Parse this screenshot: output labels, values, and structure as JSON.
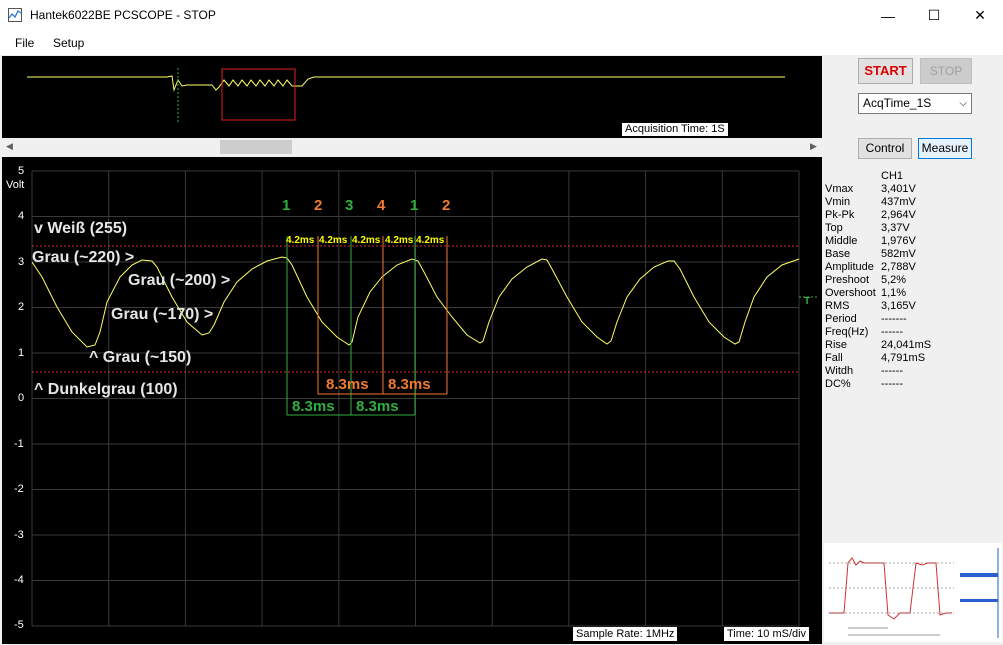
{
  "window": {
    "title": "Hantek6022BE PCSCOPE - STOP",
    "minimize": "—",
    "maximize": "☐",
    "close": "✕"
  },
  "menu": [
    "File",
    "Setup"
  ],
  "overview": {
    "acq_time_label": "Acquisition Time: 1S"
  },
  "scope": {
    "y_unit": "Volt",
    "y_ticks": [
      "5",
      "4",
      "3",
      "2",
      "1",
      "0",
      "-1",
      "-2",
      "-3",
      "-4",
      "-5"
    ],
    "annotations": [
      "v Weiß (255)",
      "Grau (~220) >",
      "Grau (~200) >",
      "Grau (~170) >",
      "^ Grau (~150)",
      "^ Dunkelgrau (100)"
    ],
    "pulse_numbers": [
      {
        "text": "1",
        "color": "#2fb040"
      },
      {
        "text": "2",
        "color": "#f07a30"
      },
      {
        "text": "3",
        "color": "#2fb040"
      },
      {
        "text": "4",
        "color": "#f07a30"
      },
      {
        "text": "1",
        "color": "#2fb040"
      },
      {
        "text": "2",
        "color": "#f07a30"
      }
    ],
    "small_intervals": [
      "4.2ms",
      "4.2ms",
      "4.2ms",
      "4.2ms",
      "4.2ms"
    ],
    "big_intervals": [
      {
        "text": "8.3ms",
        "color": "#f07a30"
      },
      {
        "text": "8.3ms",
        "color": "#f07a30"
      },
      {
        "text": "8.3ms",
        "color": "#2fb040"
      },
      {
        "text": "8.3ms",
        "color": "#2fb040"
      }
    ],
    "sample_rate": "Sample Rate: 1MHz",
    "time_div": "Time: 10 mS/div",
    "trigger_marker": "T"
  },
  "controls": {
    "start": "START",
    "stop": "STOP",
    "acq_select": "AcqTime_1S",
    "control_btn": "Control",
    "measure_btn": "Measure"
  },
  "measurements": {
    "channel": "CH1",
    "rows": [
      {
        "name": "Vmax",
        "value": "3,401V"
      },
      {
        "name": "Vmin",
        "value": "437mV"
      },
      {
        "name": "Pk-Pk",
        "value": "2,964V"
      },
      {
        "name": "Top",
        "value": "3,37V"
      },
      {
        "name": "Middle",
        "value": "1,976V"
      },
      {
        "name": "Base",
        "value": "582mV"
      },
      {
        "name": "Amplitude",
        "value": "2,788V"
      },
      {
        "name": "Preshoot",
        "value": "5,2%"
      },
      {
        "name": "Overshoot",
        "value": "1,1%"
      },
      {
        "name": "RMS",
        "value": "3,165V"
      },
      {
        "name": "Period",
        "value": "-------"
      },
      {
        "name": "Freq(Hz)",
        "value": "------"
      },
      {
        "name": "Rise",
        "value": "24,041mS"
      },
      {
        "name": "Fall",
        "value": "4,791mS"
      },
      {
        "name": "Witdh",
        "value": "------"
      },
      {
        "name": "DC%",
        "value": "------"
      }
    ]
  },
  "colors": {
    "trace": "#ffff66",
    "grid": "#3a3a3a",
    "reference_line": "#d23030",
    "start_text": "#e00000"
  }
}
